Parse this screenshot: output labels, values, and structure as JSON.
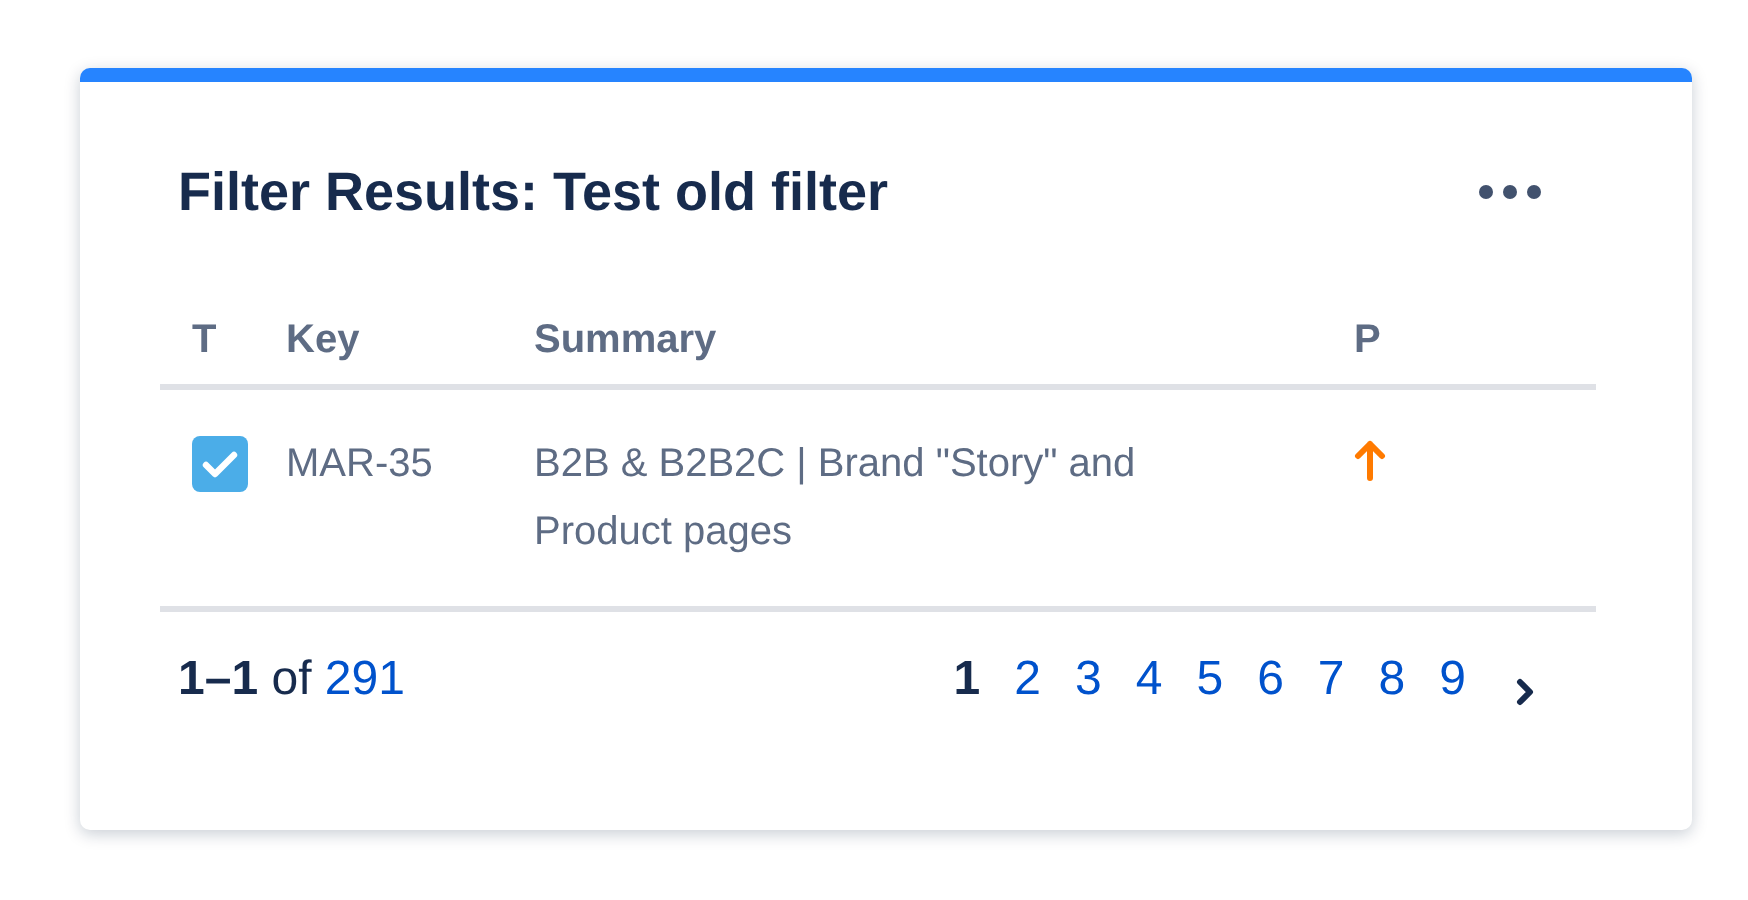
{
  "card": {
    "title": "Filter Results: Test old filter"
  },
  "table": {
    "columns": [
      "T",
      "Key",
      "Summary",
      "P"
    ],
    "rows": [
      {
        "issue_type": {
          "kind": "task"
        },
        "key": "MAR-35",
        "summary": "B2B & B2B2C | Brand \"Story\" and Product pages",
        "priority": {
          "kind": "high"
        }
      }
    ]
  },
  "pager": {
    "range": "1–1",
    "of": "of",
    "total": "291",
    "pages": [
      {
        "label": "1",
        "selected": true
      },
      {
        "label": "2",
        "selected": false
      },
      {
        "label": "3",
        "selected": false
      },
      {
        "label": "4",
        "selected": false
      },
      {
        "label": "5",
        "selected": false
      },
      {
        "label": "6",
        "selected": false
      },
      {
        "label": "7",
        "selected": false
      },
      {
        "label": "8",
        "selected": false
      },
      {
        "label": "9",
        "selected": false
      }
    ]
  }
}
